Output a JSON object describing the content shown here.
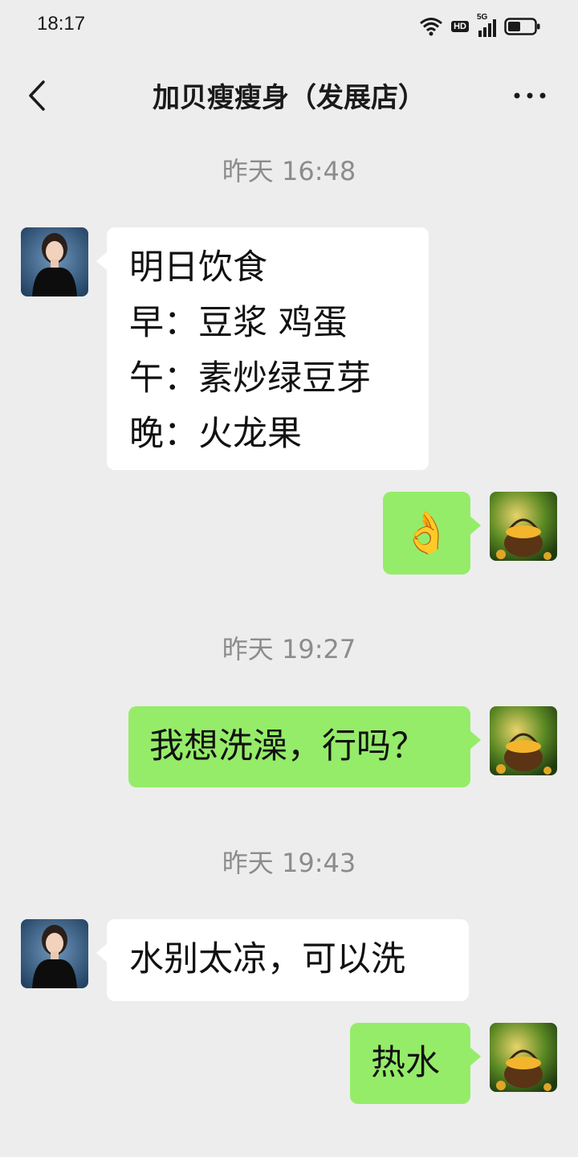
{
  "status_bar": {
    "time": "18:17",
    "hd_label": "HD",
    "network_label": "5G",
    "icons": [
      "wifi-icon",
      "hd-icon",
      "signal-icon",
      "battery-icon"
    ]
  },
  "header": {
    "title": "加贝瘦瘦身（发展店）",
    "back_icon": "chevron-left-icon",
    "more_icon": "more-dots-icon"
  },
  "colors": {
    "background": "#ededed",
    "bubble_incoming": "#ffffff",
    "bubble_outgoing": "#95ec69",
    "timestamp_text": "#8c8c8c"
  },
  "messages": [
    {
      "type": "time",
      "text": "昨天 16:48"
    },
    {
      "type": "text",
      "direction": "incoming",
      "lines": [
        "明日饮食",
        "早：豆浆 鸡蛋",
        "午：素炒绿豆芽",
        "晚：火龙果"
      ]
    },
    {
      "type": "emoji",
      "direction": "outgoing",
      "emoji": "👌"
    },
    {
      "type": "time",
      "text": "昨天 19:27"
    },
    {
      "type": "text",
      "direction": "outgoing",
      "lines": [
        "我想洗澡，行吗？"
      ]
    },
    {
      "type": "time",
      "text": "昨天 19:43"
    },
    {
      "type": "text",
      "direction": "incoming",
      "lines": [
        "水别太凉，可以洗"
      ]
    },
    {
      "type": "text",
      "direction": "outgoing",
      "lines": [
        "热水"
      ]
    }
  ]
}
